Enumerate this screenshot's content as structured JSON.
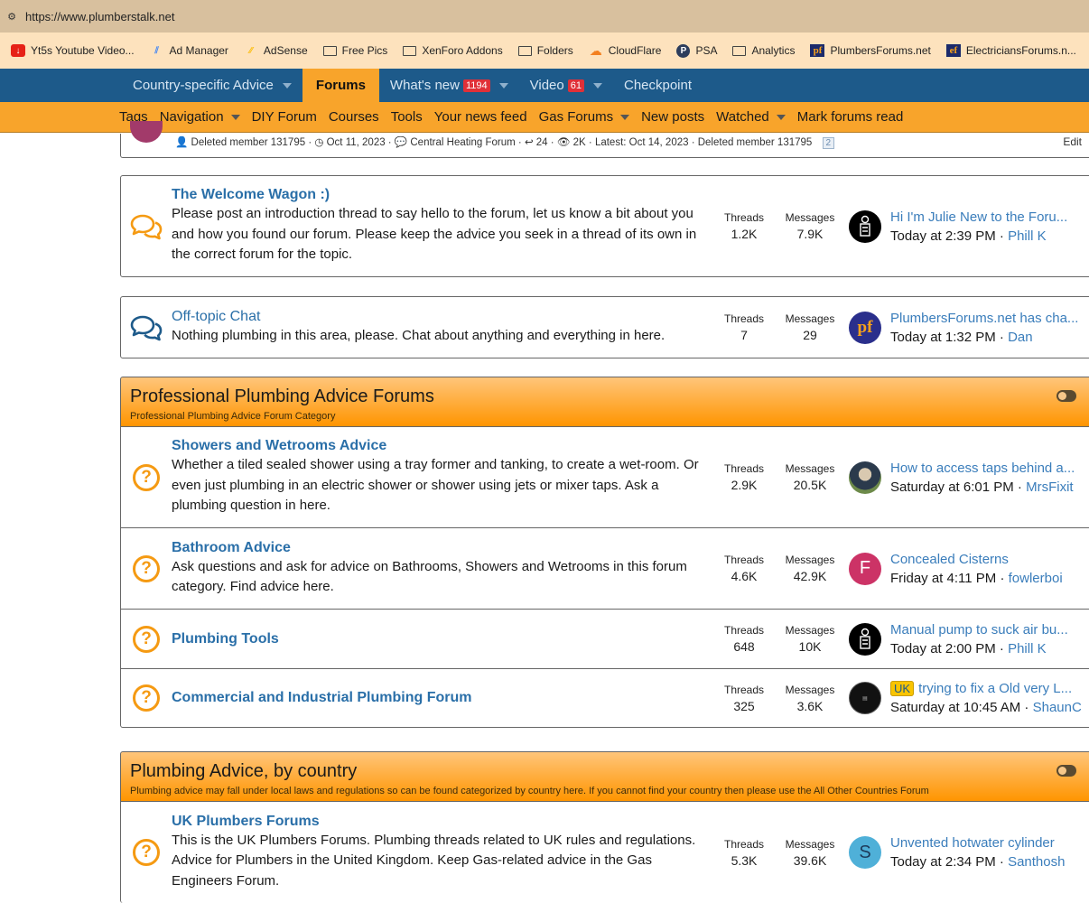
{
  "browser": {
    "url": "https://www.plumberstalk.net",
    "bookmarks": [
      {
        "label": "Yt5s Youtube Video...",
        "icon": "youtube-download-icon"
      },
      {
        "label": "Ad Manager",
        "icon": "ad-manager-icon"
      },
      {
        "label": "AdSense",
        "icon": "adsense-icon"
      },
      {
        "label": "Free Pics",
        "icon": "folder-icon"
      },
      {
        "label": "XenForo Addons",
        "icon": "folder-icon"
      },
      {
        "label": "Folders",
        "icon": "folder-icon"
      },
      {
        "label": "CloudFlare",
        "icon": "cloudflare-icon"
      },
      {
        "label": "PSA",
        "icon": "psa-icon"
      },
      {
        "label": "Analytics",
        "icon": "folder-icon"
      },
      {
        "label": "PlumbersForums.net",
        "icon": "pf-icon"
      },
      {
        "label": "ElectriciansForums.n...",
        "icon": "ef-icon"
      }
    ]
  },
  "nav": {
    "primary": [
      {
        "label": "Country-specific Advice",
        "dropdown": true
      },
      {
        "label": "Forums",
        "active": true
      },
      {
        "label": "What's new",
        "badge": "1194",
        "dropdown": true
      },
      {
        "label": "Video",
        "badge": "61",
        "dropdown": true
      },
      {
        "label": "Checkpoint"
      }
    ],
    "secondary": [
      {
        "label": "Tags"
      },
      {
        "label": "Navigation",
        "dropdown": true
      },
      {
        "label": "DIY Forum"
      },
      {
        "label": "Courses"
      },
      {
        "label": "Tools"
      },
      {
        "label": "Your news feed"
      },
      {
        "label": "Gas Forums",
        "dropdown": true
      },
      {
        "label": "New posts"
      },
      {
        "label": "Watched",
        "dropdown": true
      },
      {
        "label": "Mark forums read"
      }
    ]
  },
  "partial_thread": {
    "author": "Deleted member 131795",
    "date": "Oct 11, 2023",
    "forum": "Central Heating Forum",
    "replies": "24",
    "views": "2K",
    "latest": "Latest: Oct 14, 2023 · Deleted member 131795",
    "page": "2",
    "edit": "Edit"
  },
  "labels": {
    "threads": "Threads",
    "messages": "Messages",
    "sep": " · "
  },
  "standalone_nodes": [
    {
      "title": "The Welcome Wagon :)",
      "desc": "Please post an introduction thread to say hello to the forum, let us know a bit about you and how you found our forum. Please keep the advice you seek in a thread of its own in the correct forum for the topic.",
      "threads": "1.2K",
      "messages": "7.9K",
      "last_title": "Hi I'm Julie New to the Foru...",
      "last_time": "Today at 2:39 PM",
      "last_user": "Phill K",
      "icon": "chat-bubbles-orange",
      "unread": true
    },
    {
      "title": "Off-topic Chat",
      "desc": "Nothing plumbing in this area, please. Chat about anything and everything in here.",
      "threads": "7",
      "messages": "29",
      "last_title": "PlumbersForums.net has cha...",
      "last_time": "Today at 1:32 PM",
      "last_user": "Dan",
      "icon": "chat-bubbles-blue",
      "unread": false
    }
  ],
  "categories": [
    {
      "title": "Professional Plumbing Advice Forums",
      "desc": "Professional Plumbing Advice Forum Category",
      "nodes": [
        {
          "title": "Showers and Wetrooms Advice",
          "desc": "Whether a tiled sealed shower using a tray former and tanking, to create a wet-room. Or even just plumbing in an electric shower or shower using jets or mixer taps. Ask a plumbing question in here.",
          "threads": "2.9K",
          "messages": "20.5K",
          "last_title": "How to access taps behind a...",
          "last_time": "Saturday at 6:01 PM",
          "last_user": "MrsFixit"
        },
        {
          "title": "Bathroom Advice",
          "desc": "Ask questions and ask for advice on Bathrooms, Showers and Wetrooms in this forum category. Find advice here.",
          "threads": "4.6K",
          "messages": "42.9K",
          "last_title": "Concealed Cisterns",
          "last_time": "Friday at 4:11 PM",
          "last_user": "fowlerboi",
          "avatar_letter": "F"
        },
        {
          "title": "Plumbing Tools",
          "desc": "",
          "threads": "648",
          "messages": "10K",
          "last_title": "Manual pump to suck air bu...",
          "last_time": "Today at 2:00 PM",
          "last_user": "Phill K"
        },
        {
          "title": "Commercial and Industrial Plumbing Forum",
          "desc": "",
          "threads": "325",
          "messages": "3.6K",
          "last_prefix": "UK",
          "last_title": "trying to fix a Old very L...",
          "last_time": "Saturday at 10:45 AM",
          "last_user": "ShaunC"
        }
      ]
    },
    {
      "title": "Plumbing Advice, by country",
      "desc": "Plumbing advice may fall under local laws and regulations so can be found categorized by country here. If you cannot find your country then please use the All Other Countries Forum",
      "nodes": [
        {
          "title": "UK Plumbers Forums",
          "desc": "This is the UK Plumbers Forums. Plumbing threads related to UK rules and regulations. Advice for Plumbers in the United Kingdom. Keep Gas-related advice in the Gas Engineers Forum.",
          "threads": "5.3K",
          "messages": "39.6K",
          "last_title": "Unvented hotwater cylinder",
          "last_time": "Today at 2:34 PM",
          "last_user": "Santhosh",
          "avatar_letter": "S"
        }
      ]
    }
  ],
  "colors": {
    "nav_blue": "#1d5a8a",
    "accent_orange": "#f8a42b",
    "link_blue": "#2a6fa8",
    "badge_red": "#e03038"
  }
}
